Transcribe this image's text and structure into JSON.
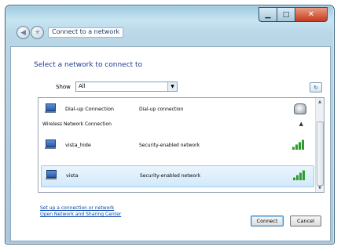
{
  "window": {
    "breadcrumb": "Connect to a network",
    "caption_icons": [
      "minimize-icon",
      "maximize-icon",
      "close-icon"
    ]
  },
  "main": {
    "heading": "Select a network to connect to",
    "show_label": "Show",
    "show_value": "All"
  },
  "list": {
    "rows": [
      {
        "name": "Dial-up Connection",
        "status": "Dial-up connection",
        "icon": "network-computer-icon",
        "status_icon": "phone-icon"
      },
      {
        "name": "vista_hide",
        "status": "Security-enabled network",
        "icon": "network-computer-icon",
        "status_icon": "signal-strength-icon"
      },
      {
        "name": "vista",
        "status": "Security-enabled network",
        "icon": "network-computer-icon",
        "status_icon": "signal-strength-icon"
      }
    ],
    "group_header": "Wireless Network Connection"
  },
  "links": {
    "setup": "Set up a connection or network",
    "network_center": "Open Network and Sharing Center"
  },
  "buttons": {
    "connect": "Connect",
    "cancel": "Cancel"
  },
  "colors": {
    "selection": "#d3e9fa",
    "accent": "#1e3d8f",
    "signal": "#2f9b2f"
  }
}
